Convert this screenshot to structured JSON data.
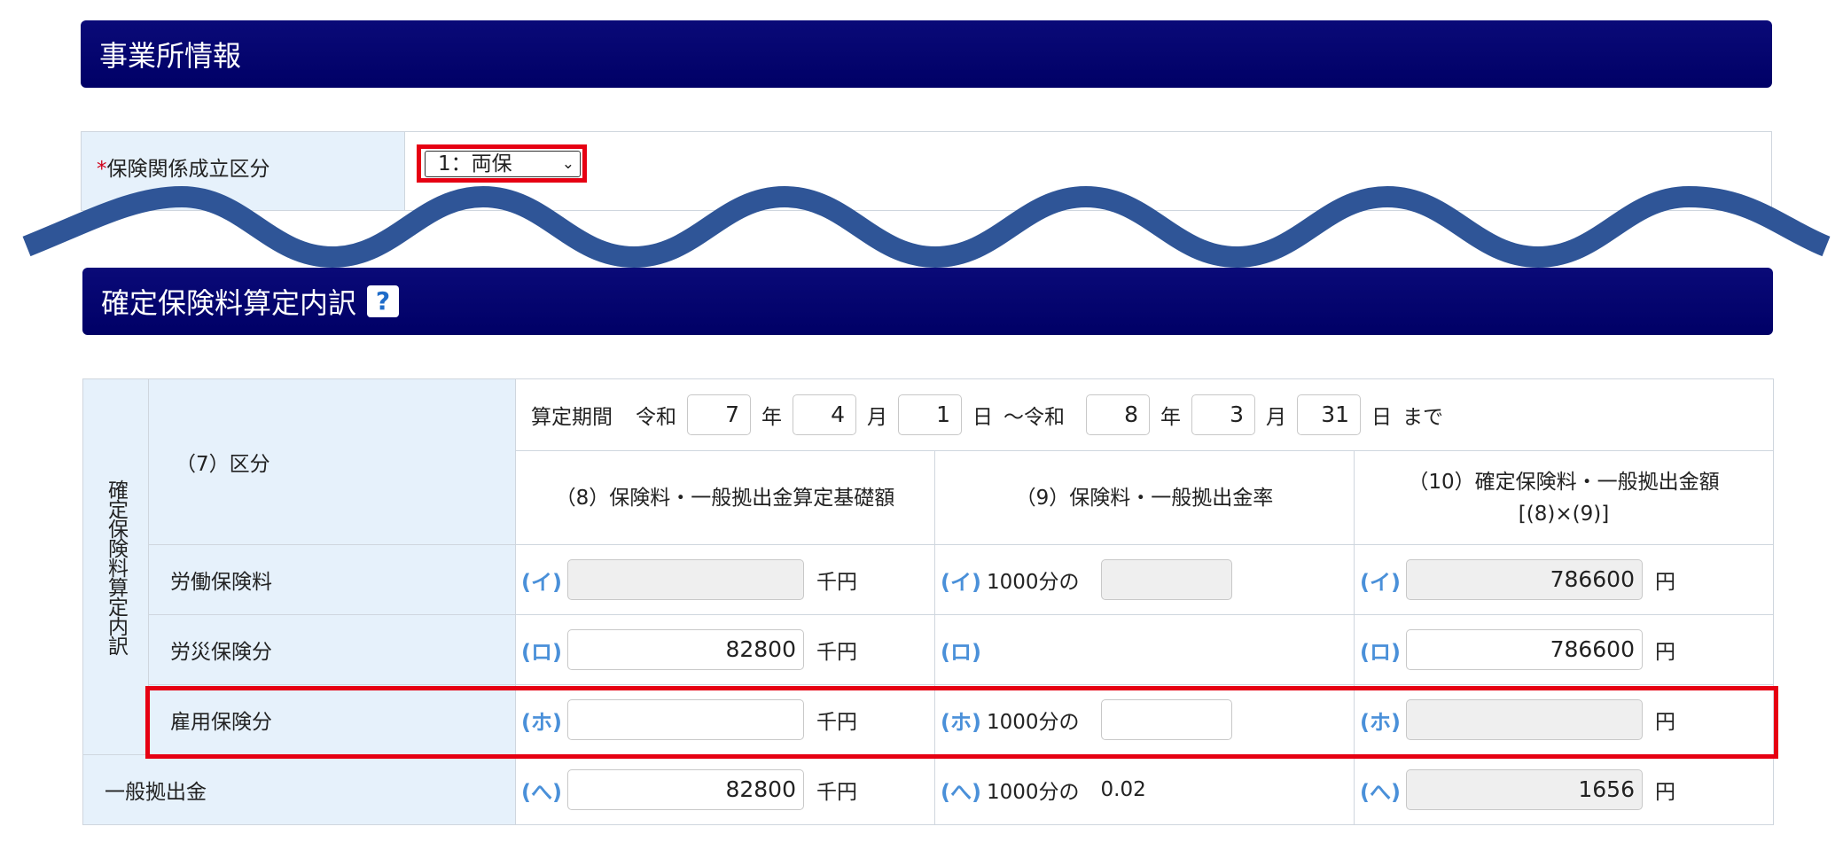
{
  "sections": {
    "office_info_title": "事業所情報",
    "calc_breakdown_title": "確定保険料算定内訳",
    "help_label": "?"
  },
  "office_info": {
    "required_mark": "*",
    "label": "保険関係成立区分",
    "selected_value": "1：両保"
  },
  "calc_table": {
    "vertical_label": "確定保険料算定内訳",
    "category_header": "（7）区分",
    "period": {
      "prefix": "算定期間",
      "era_start": "令和",
      "start_year": "7",
      "start_month": "4",
      "start_day": "1",
      "year_unit": "年",
      "month_unit": "月",
      "day_unit": "日",
      "separator": "～令和",
      "end_year": "8",
      "end_month": "3",
      "end_day": "31",
      "suffix": "まで"
    },
    "col8_header": "（8）保険料・一般拠出金算定基礎額",
    "col9_header": "（9）保険料・一般拠出金率",
    "col10_header_line1": "（10）確定保険料・一般拠出金額",
    "col10_header_line2": "[(8)×(9)]",
    "unit_thousand_yen": "千円",
    "unit_yen": "円",
    "rate_prefix": "1000分の",
    "rows": [
      {
        "label": "労働保険料",
        "marker": "(イ)",
        "base": "",
        "rate": "",
        "amount": "786600"
      },
      {
        "label": "労災保険分",
        "marker": "(ロ)",
        "base": "82800",
        "rate": "",
        "amount": "786600"
      },
      {
        "label": "雇用保険分",
        "marker": "(ホ)",
        "base": "",
        "rate": "",
        "amount": ""
      },
      {
        "label": "一般拠出金",
        "marker": "(へ)",
        "base": "82800",
        "rate": "0.02",
        "amount": "1656"
      }
    ]
  },
  "colors": {
    "header_bg": "#000066",
    "label_bg": "#e6f1fb",
    "highlight": "#e60012",
    "wave": "#2f5597",
    "marker": "#4a90d9"
  }
}
